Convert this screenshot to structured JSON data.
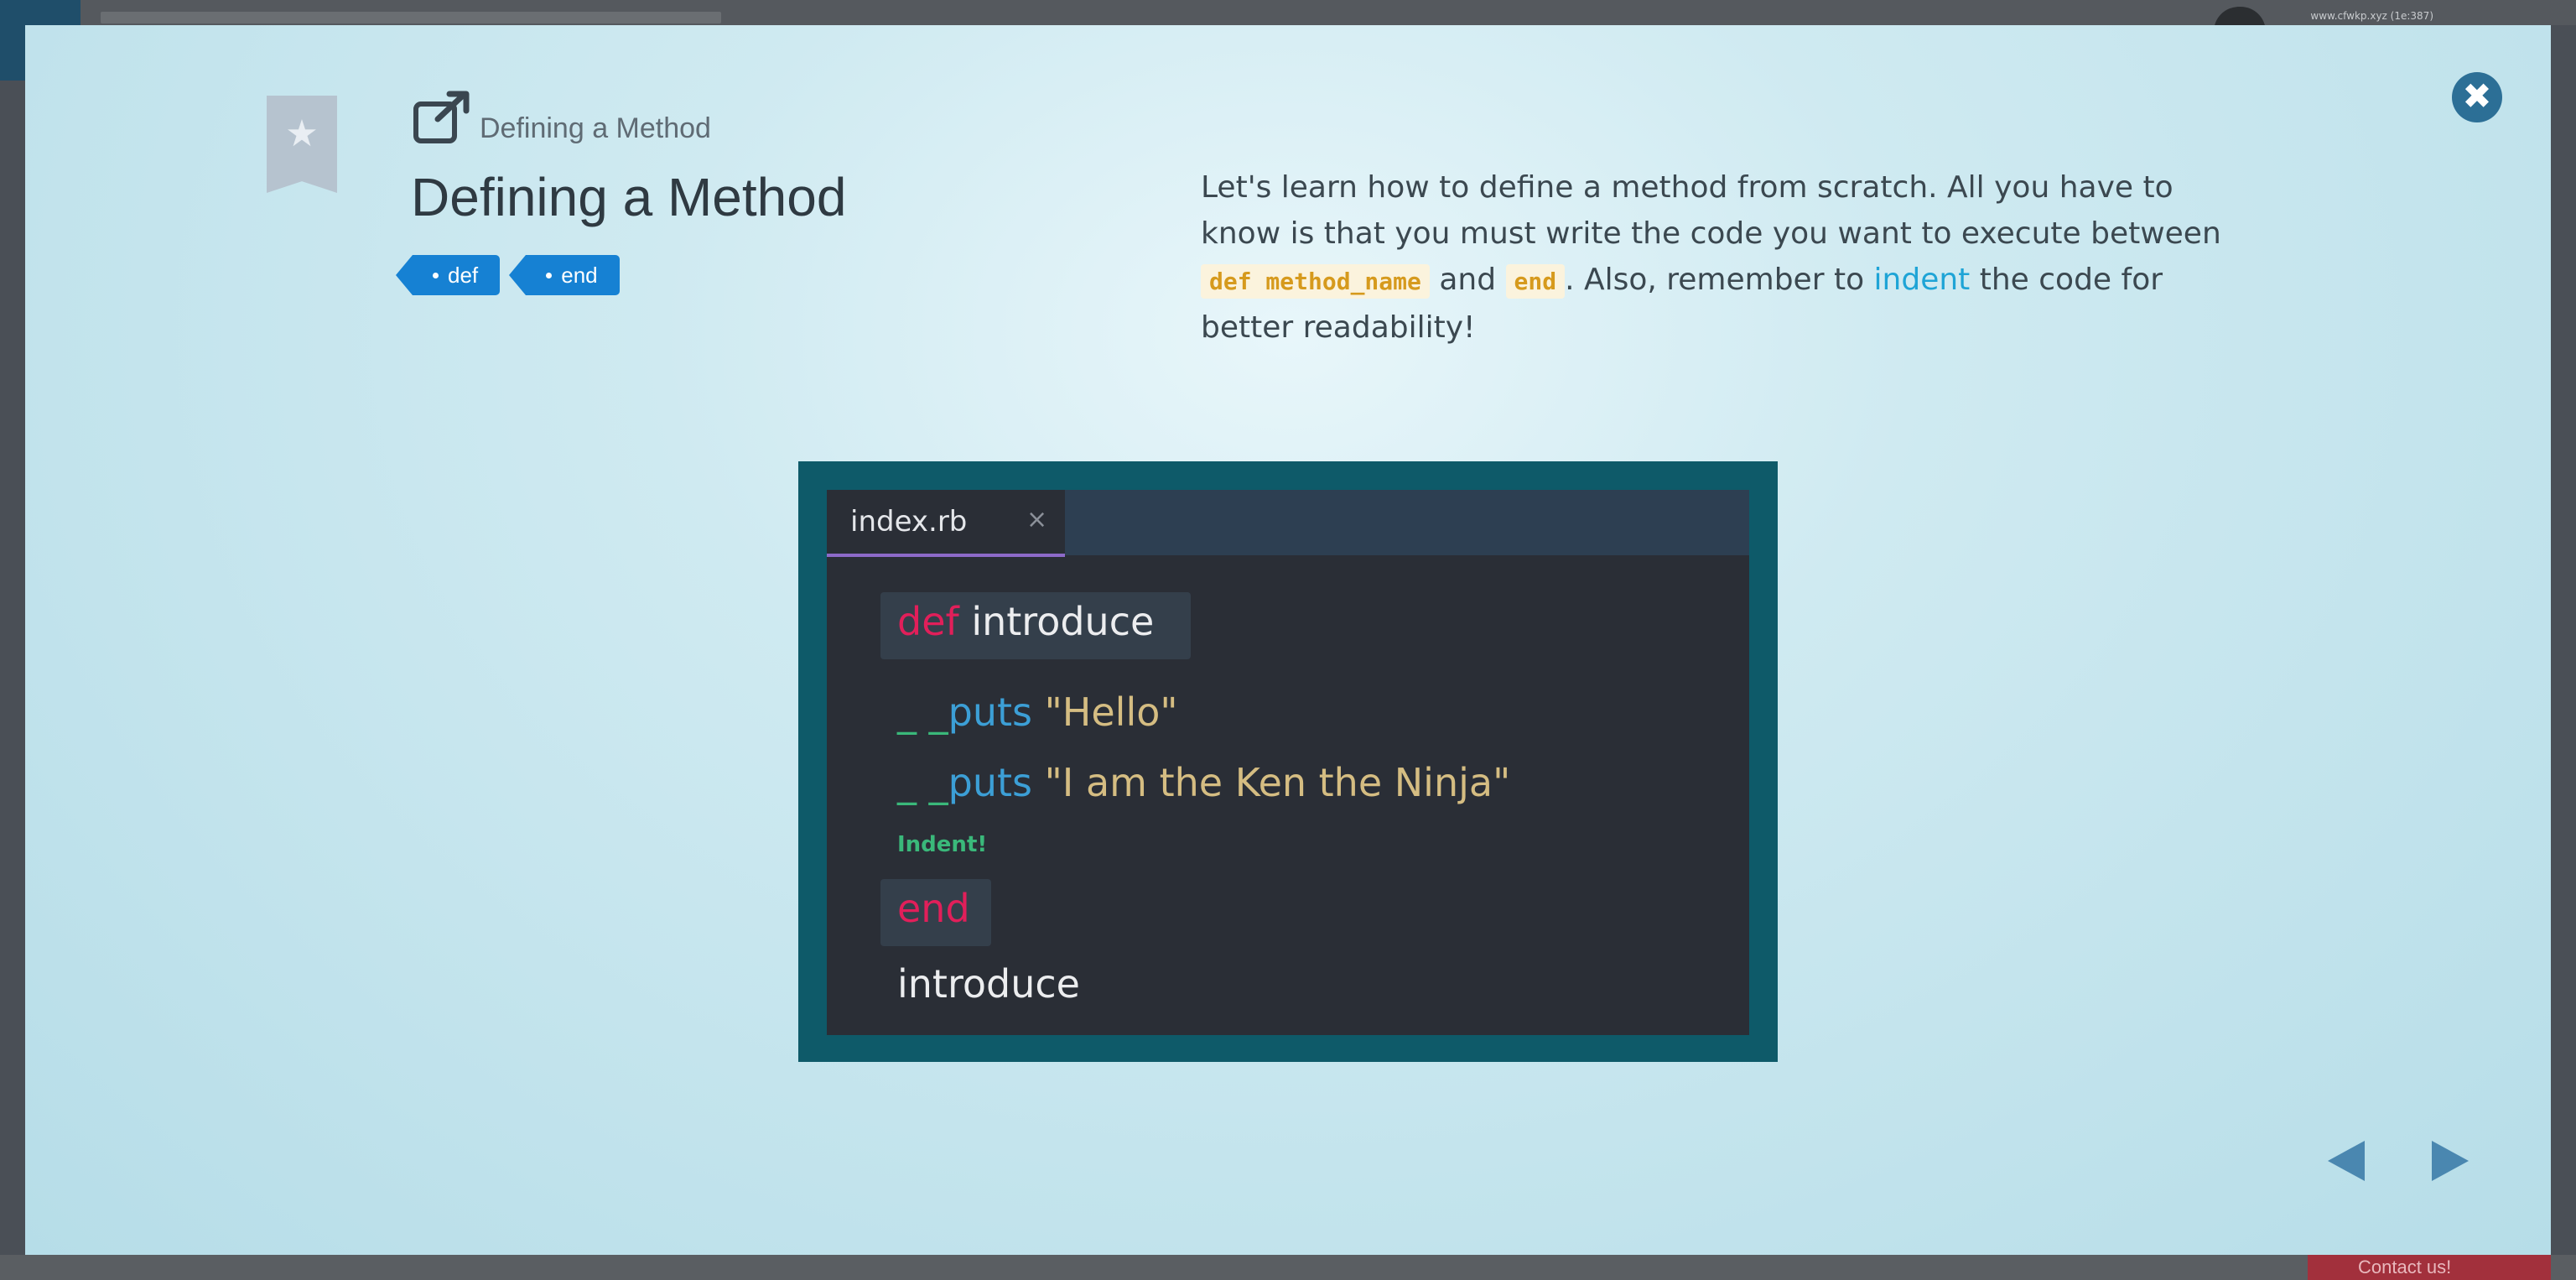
{
  "background": {
    "url_text": "www.cfwkp.xyz (1e:387)",
    "contact_label": "Contact us!"
  },
  "modal": {
    "breadcrumb": "Defining a Method",
    "title": "Defining a Method",
    "tags": [
      "def",
      "end"
    ],
    "description": {
      "part1": "Let's learn how to define a method from scratch. All you have to know is that you must write the code you want to execute between ",
      "code1": "def method_name",
      "part2": " and ",
      "code2": "end",
      "part3": ". Also, remember to ",
      "link": "indent",
      "part4": " the code for better readability!"
    },
    "figure": {
      "tab_filename": "index.rb",
      "tab_close": "×",
      "line1_kw": "def",
      "line1_name": "introduce",
      "line2_indent": "_ _",
      "line2_fn": "puts",
      "line2_str": "\"Hello\"",
      "line3_indent": "_ _",
      "line3_fn": "puts",
      "line3_str": "\"I am the Ken the Ninja\"",
      "indent_note": "Indent!",
      "line4_kw": "end",
      "line5": "introduce"
    },
    "close_icon": "close-icon",
    "colors": {
      "accent": "#1681d3",
      "keyword": "#e11f5a",
      "function": "#3c9fd6",
      "string": "#d5bd82",
      "code_inline": "#d69a1d",
      "link": "#1ea4d6"
    }
  }
}
